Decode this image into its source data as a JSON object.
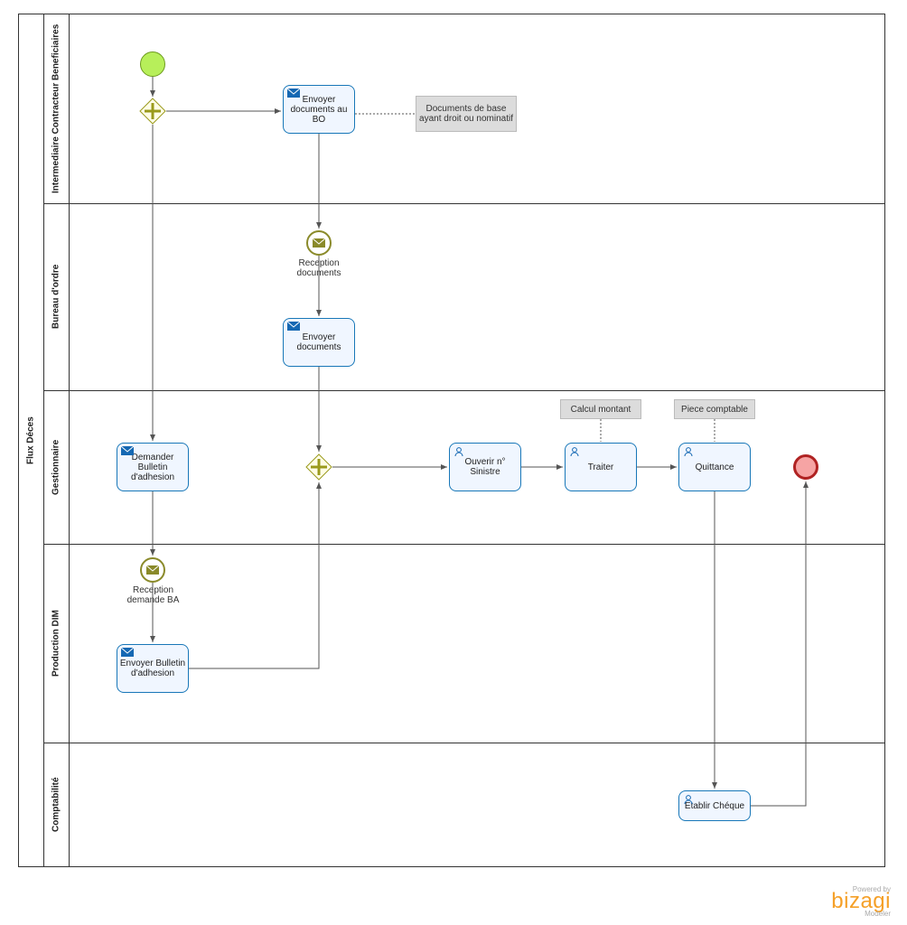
{
  "pool": {
    "label": "Flux Déces"
  },
  "lanes": {
    "l1": "Intermediaire Contracteur Beneficiaires",
    "l2": "Bureau d'ordre",
    "l3": "Gestionnaire",
    "l4": "Production DIM",
    "l5": "Comptabilité"
  },
  "tasks": {
    "envoyer_bo": "Envoyer documents au BO",
    "envoyer_docs": "Envoyer documents",
    "demander_ba": "Demander Bulletin d'adhesion",
    "envoyer_ba": "Envoyer Bulletin d'adhesion",
    "ouvrir": "Ouverir n° Sinistre",
    "traiter": "Traiter",
    "quittance": "Quittance",
    "cheque": "Etablir Chéque"
  },
  "events": {
    "recep_docs": "Reception documents",
    "recep_ba": "Reception demande BA"
  },
  "annotations": {
    "docs_base": "Documents de base ayant droit ou nominatif",
    "calcul": "Calcul montant",
    "piece": "Piece comptable"
  },
  "footer": {
    "powered": "Powered by",
    "brand": "bizagi",
    "modeler": "Modeler"
  },
  "chart_data": {
    "type": "bpmn-process",
    "pool": "Flux Déces",
    "lanes": [
      "Intermediaire Contracteur Beneficiaires",
      "Bureau d'ordre",
      "Gestionnaire",
      "Production DIM",
      "Comptabilité"
    ],
    "nodes": [
      {
        "id": "start",
        "type": "startEvent",
        "lane": "Intermediaire Contracteur Beneficiaires"
      },
      {
        "id": "gw1",
        "type": "parallelGateway",
        "lane": "Intermediaire Contracteur Beneficiaires"
      },
      {
        "id": "t_envoyer_bo",
        "type": "sendTask",
        "lane": "Intermediaire Contracteur Beneficiaires",
        "label": "Envoyer documents au BO"
      },
      {
        "id": "e_recep_docs",
        "type": "messageIntermediateCatch",
        "lane": "Bureau d'ordre",
        "label": "Reception documents"
      },
      {
        "id": "t_envoyer_docs",
        "type": "sendTask",
        "lane": "Bureau d'ordre",
        "label": "Envoyer documents"
      },
      {
        "id": "t_demander_ba",
        "type": "sendTask",
        "lane": "Gestionnaire",
        "label": "Demander Bulletin d'adhesion"
      },
      {
        "id": "e_recep_ba",
        "type": "messageIntermediateCatch",
        "lane": "Production DIM",
        "label": "Reception demande BA"
      },
      {
        "id": "t_envoyer_ba",
        "type": "sendTask",
        "lane": "Production DIM",
        "label": "Envoyer Bulletin d'adhesion"
      },
      {
        "id": "gw2",
        "type": "parallelGateway",
        "lane": "Gestionnaire"
      },
      {
        "id": "t_ouvrir",
        "type": "userTask",
        "lane": "Gestionnaire",
        "label": "Ouverir n° Sinistre"
      },
      {
        "id": "t_traiter",
        "type": "userTask",
        "lane": "Gestionnaire",
        "label": "Traiter"
      },
      {
        "id": "t_quittance",
        "type": "userTask",
        "lane": "Gestionnaire",
        "label": "Quittance"
      },
      {
        "id": "t_cheque",
        "type": "userTask",
        "lane": "Comptabilité",
        "label": "Etablir Chéque"
      },
      {
        "id": "end",
        "type": "endEvent",
        "lane": "Gestionnaire"
      }
    ],
    "sequenceFlows": [
      [
        "start",
        "gw1"
      ],
      [
        "gw1",
        "t_envoyer_bo"
      ],
      [
        "gw1",
        "t_demander_ba"
      ],
      [
        "t_envoyer_bo",
        "e_recep_docs"
      ],
      [
        "e_recep_docs",
        "t_envoyer_docs"
      ],
      [
        "t_envoyer_docs",
        "gw2"
      ],
      [
        "t_demander_ba",
        "e_recep_ba"
      ],
      [
        "e_recep_ba",
        "t_envoyer_ba"
      ],
      [
        "t_envoyer_ba",
        "gw2"
      ],
      [
        "gw2",
        "t_ouvrir"
      ],
      [
        "t_ouvrir",
        "t_traiter"
      ],
      [
        "t_traiter",
        "t_quittance"
      ],
      [
        "t_quittance",
        "t_cheque"
      ],
      [
        "t_cheque",
        "end"
      ]
    ],
    "textAnnotations": [
      {
        "ref": "t_envoyer_bo",
        "text": "Documents de base ayant droit ou nominatif"
      },
      {
        "ref": "t_traiter",
        "text": "Calcul montant"
      },
      {
        "ref": "t_quittance",
        "text": "Piece comptable"
      }
    ]
  }
}
